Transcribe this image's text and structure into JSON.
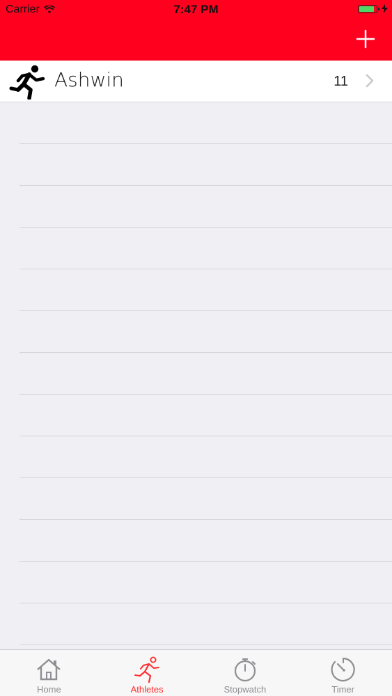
{
  "status_bar": {
    "carrier": "Carrier",
    "time": "7:47 PM",
    "battery_level": 0.8,
    "icons": [
      "wifi-icon",
      "battery-icon",
      "charging-bolt-icon"
    ]
  },
  "nav": {
    "add_icon": "plus-icon"
  },
  "athletes": [
    {
      "name": "Ashwin",
      "count": "11",
      "icon": "runner-icon"
    }
  ],
  "tabs": [
    {
      "label": "Home",
      "icon": "home-icon",
      "active": false
    },
    {
      "label": "Athletes",
      "icon": "runner-icon",
      "active": true
    },
    {
      "label": "Stopwatch",
      "icon": "stopwatch-icon",
      "active": false
    },
    {
      "label": "Timer",
      "icon": "timer-icon",
      "active": false
    }
  ],
  "colors": {
    "header": "#ff001f",
    "accent": "#ff2d2d",
    "tab_inactive": "#8e8e93",
    "background": "#efeff4"
  }
}
